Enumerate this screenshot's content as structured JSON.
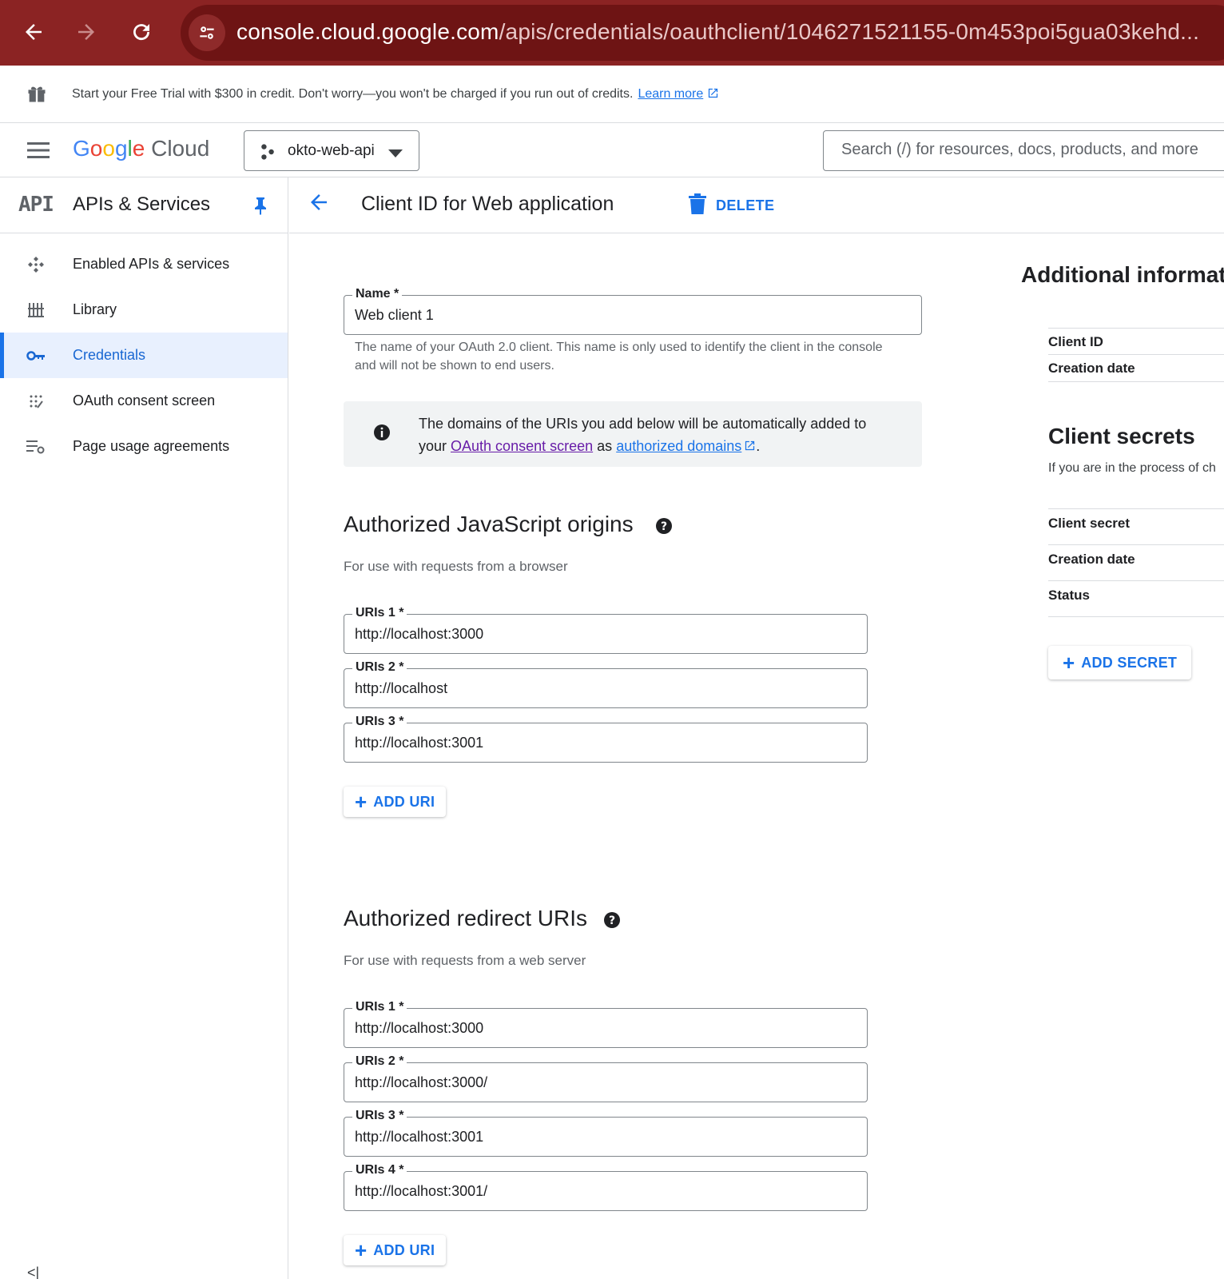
{
  "browser": {
    "url_host": "console.cloud.google.com",
    "url_path": "/apis/credentials/oauthclient/1046271521155-0m453poi5gua03kehd..."
  },
  "trial": {
    "text": "Start your Free Trial with $300 in credit. Don't worry—you won't be charged if you run out of credits.",
    "link": "Learn more"
  },
  "header": {
    "logo_google": "Google",
    "logo_cloud": "Cloud",
    "project": "okto-web-api",
    "search_placeholder": "Search (/) for resources, docs, products, and more"
  },
  "sidebar": {
    "badge": "API",
    "title": "APIs & Services",
    "items": [
      {
        "label": "Enabled APIs & services",
        "icon": "apis-icon"
      },
      {
        "label": "Library",
        "icon": "library-icon"
      },
      {
        "label": "Credentials",
        "icon": "key-icon",
        "active": true
      },
      {
        "label": "OAuth consent screen",
        "icon": "consent-icon"
      },
      {
        "label": "Page usage agreements",
        "icon": "agreements-icon"
      }
    ],
    "collapse": "<|"
  },
  "page": {
    "title": "Client ID for Web application",
    "delete": "DELETE"
  },
  "name_field": {
    "label": "Name *",
    "value": "Web client 1",
    "helper": "The name of your OAuth 2.0 client. This name is only used to identify the client in the console and will not be shown to end users."
  },
  "info": {
    "text_before": "The domains of the URIs you add below will be automatically added to your",
    "link1": "OAuth consent screen",
    "text_mid": "as",
    "link2": "authorized domains",
    "text_end": "."
  },
  "js_origins": {
    "title": "Authorized JavaScript origins",
    "subtitle": "For use with requests from a browser",
    "uris": [
      {
        "label": "URIs 1 *",
        "value": "http://localhost:3000"
      },
      {
        "label": "URIs 2 *",
        "value": "http://localhost"
      },
      {
        "label": "URIs 3 *",
        "value": "http://localhost:3001"
      }
    ],
    "add": "ADD URI"
  },
  "redirect": {
    "title": "Authorized redirect URIs",
    "subtitle": "For use with requests from a web server",
    "uris": [
      {
        "label": "URIs 1 *",
        "value": "http://localhost:3000"
      },
      {
        "label": "URIs 2 *",
        "value": "http://localhost:3000/"
      },
      {
        "label": "URIs 3 *",
        "value": "http://localhost:3001"
      },
      {
        "label": "URIs 4 *",
        "value": "http://localhost:3001/"
      }
    ],
    "add": "ADD URI"
  },
  "right": {
    "title": "Additional informati",
    "rows1": [
      "Client ID",
      "Creation date"
    ],
    "secrets_title": "Client secrets",
    "secrets_desc": "If you are in the process of ch",
    "rows2": [
      "Client secret",
      "Creation date",
      "Status"
    ],
    "add_secret": "ADD SECRET"
  },
  "colors": {
    "browser_bar": "#8b2323",
    "accent": "#1a73e8"
  }
}
